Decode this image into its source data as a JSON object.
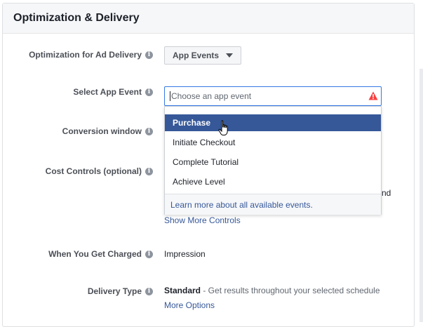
{
  "section": {
    "title": "Optimization & Delivery"
  },
  "rows": {
    "optimization": {
      "label": "Optimization for Ad Delivery",
      "value": "App Events"
    },
    "app_event": {
      "label": "Select App Event",
      "placeholder": "Choose an app event"
    },
    "conversion_window": {
      "label": "Conversion window"
    },
    "cost_controls": {
      "label": "Cost Controls (optional)",
      "hidden_tail": "nd"
    },
    "show_more": {
      "label": "Show More Controls"
    },
    "charged": {
      "label": "When You Get Charged",
      "value": "Impression"
    },
    "delivery": {
      "label": "Delivery Type",
      "value_bold": "Standard",
      "value_rest": " - Get results throughout your selected schedule",
      "more_options": "More Options"
    }
  },
  "dropdown": {
    "items": [
      {
        "label": "Purchase",
        "selected": true
      },
      {
        "label": "Initiate Checkout",
        "selected": false
      },
      {
        "label": "Complete Tutorial",
        "selected": false
      },
      {
        "label": "Achieve Level",
        "selected": false
      }
    ],
    "footer_link": "Learn more about all available events."
  },
  "icons": {
    "info": "info-icon",
    "caret": "caret-down-icon",
    "warning": "warning-icon",
    "cursor": "hand-pointer-icon"
  },
  "colors": {
    "accent": "#365899",
    "input_focus": "#3578e5",
    "warning": "#fa3e3e",
    "label": "#4b4f56"
  }
}
